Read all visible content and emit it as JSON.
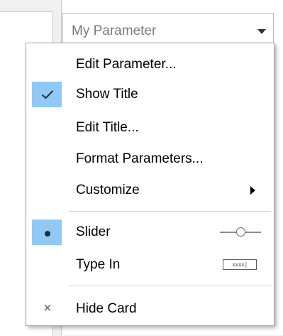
{
  "parameter_card": {
    "title": "My Parameter"
  },
  "menu": {
    "edit_parameter": "Edit Parameter...",
    "show_title": "Show Title",
    "edit_title": "Edit Title...",
    "format_parameters": "Format Parameters...",
    "customize": "Customize",
    "slider": "Slider",
    "type_in": "Type In",
    "type_in_glyph_text": "xxxx|",
    "hide_card": "Hide Card"
  },
  "state": {
    "show_title_checked": true,
    "slider_selected": true,
    "type_in_selected": false
  },
  "icons": {
    "check": "checkmark-icon",
    "bullet": "radio-dot-icon",
    "close": "close-icon",
    "submenu": "submenu-arrow-icon",
    "dropdown": "dropdown-arrow-icon",
    "slider": "slider-icon",
    "type_in": "text-input-icon"
  },
  "colors": {
    "selection_highlight": "#90c8f6",
    "menu_background": "#ffffff",
    "separator": "#d4d4d4"
  }
}
